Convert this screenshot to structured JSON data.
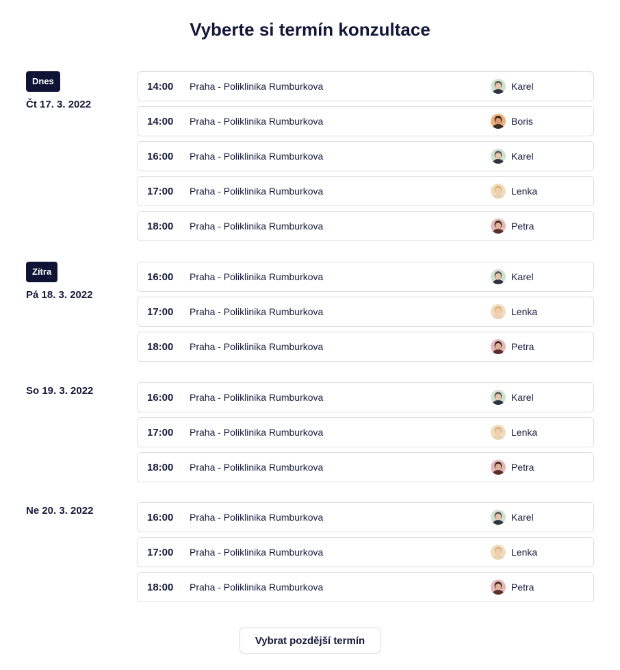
{
  "title": "Vyberte si termín konzultace",
  "later_button": "Vybrat pozdější termín",
  "days": [
    {
      "badge": "Dnes",
      "date": "Čt 17. 3. 2022",
      "slots": [
        {
          "time": "14:00",
          "location": "Praha - Poliklinika Rumburkova",
          "doctor": "Karel",
          "avatar": "karel"
        },
        {
          "time": "14:00",
          "location": "Praha - Poliklinika Rumburkova",
          "doctor": "Boris",
          "avatar": "boris"
        },
        {
          "time": "16:00",
          "location": "Praha - Poliklinika Rumburkova",
          "doctor": "Karel",
          "avatar": "karel"
        },
        {
          "time": "17:00",
          "location": "Praha - Poliklinika Rumburkova",
          "doctor": "Lenka",
          "avatar": "lenka"
        },
        {
          "time": "18:00",
          "location": "Praha - Poliklinika Rumburkova",
          "doctor": "Petra",
          "avatar": "petra"
        }
      ]
    },
    {
      "badge": "Zítra",
      "date": "Pá 18. 3. 2022",
      "slots": [
        {
          "time": "16:00",
          "location": "Praha - Poliklinika Rumburkova",
          "doctor": "Karel",
          "avatar": "karel"
        },
        {
          "time": "17:00",
          "location": "Praha - Poliklinika Rumburkova",
          "doctor": "Lenka",
          "avatar": "lenka"
        },
        {
          "time": "18:00",
          "location": "Praha - Poliklinika Rumburkova",
          "doctor": "Petra",
          "avatar": "petra"
        }
      ]
    },
    {
      "badge": "",
      "date": "So 19. 3. 2022",
      "slots": [
        {
          "time": "16:00",
          "location": "Praha - Poliklinika Rumburkova",
          "doctor": "Karel",
          "avatar": "karel"
        },
        {
          "time": "17:00",
          "location": "Praha - Poliklinika Rumburkova",
          "doctor": "Lenka",
          "avatar": "lenka"
        },
        {
          "time": "18:00",
          "location": "Praha - Poliklinika Rumburkova",
          "doctor": "Petra",
          "avatar": "petra"
        }
      ]
    },
    {
      "badge": "",
      "date": "Ne 20. 3. 2022",
      "slots": [
        {
          "time": "16:00",
          "location": "Praha - Poliklinika Rumburkova",
          "doctor": "Karel",
          "avatar": "karel"
        },
        {
          "time": "17:00",
          "location": "Praha - Poliklinika Rumburkova",
          "doctor": "Lenka",
          "avatar": "lenka"
        },
        {
          "time": "18:00",
          "location": "Praha - Poliklinika Rumburkova",
          "doctor": "Petra",
          "avatar": "petra"
        }
      ]
    }
  ],
  "avatar_colors": {
    "karel": {
      "bg": "#cfe3cf",
      "skin": "#e8c4a8",
      "hair": "#5a5a5a",
      "shirt": "#2e3340"
    },
    "boris": {
      "bg": "#f0b07a",
      "skin": "#d99a70",
      "hair": "#2a211c",
      "shirt": "#3a2b22"
    },
    "lenka": {
      "bg": "#f2dcc0",
      "skin": "#f0cfae",
      "hair": "#d9b47a",
      "shirt": "#e8d2b2"
    },
    "petra": {
      "bg": "#e6b9b9",
      "skin": "#e0b294",
      "hair": "#3b2420",
      "shirt": "#5a2f2c"
    }
  }
}
